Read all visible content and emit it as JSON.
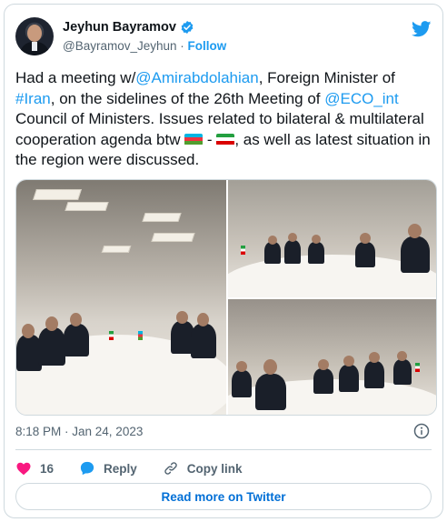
{
  "author": {
    "name": "Jeyhun Bayramov",
    "handle": "@Bayramov_Jeyhun",
    "separator": "·",
    "follow_label": "Follow"
  },
  "tweet": {
    "seg1": "Had a meeting w/",
    "mention1": "@Amirabdolahian",
    "seg2": ", Foreign Minister of ",
    "hashtag": "#Iran",
    "seg3": ", on the sidelines of the 26th Meeting of ",
    "mention2": "@ECO_int",
    "seg4": " Council of Ministers. Issues related to bilateral & multilateral cooperation agenda btw ",
    "flag_separator": " - ",
    "seg5": ", as well as latest situation in the region were discussed."
  },
  "flags": {
    "azerbaijan": [
      "#00b5e2",
      "#ef3340",
      "#509e2f"
    ],
    "iran": [
      "#239f40",
      "#ffffff",
      "#da0000"
    ]
  },
  "timestamp": "8:18 PM · Jan 24, 2023",
  "actions": {
    "like_count": "16",
    "reply_label": "Reply",
    "copy_label": "Copy link"
  },
  "read_more_label": "Read more on Twitter",
  "colors": {
    "accent": "#1d9bf0",
    "like": "#f91880",
    "text": "#0f1419",
    "muted": "#536471"
  }
}
